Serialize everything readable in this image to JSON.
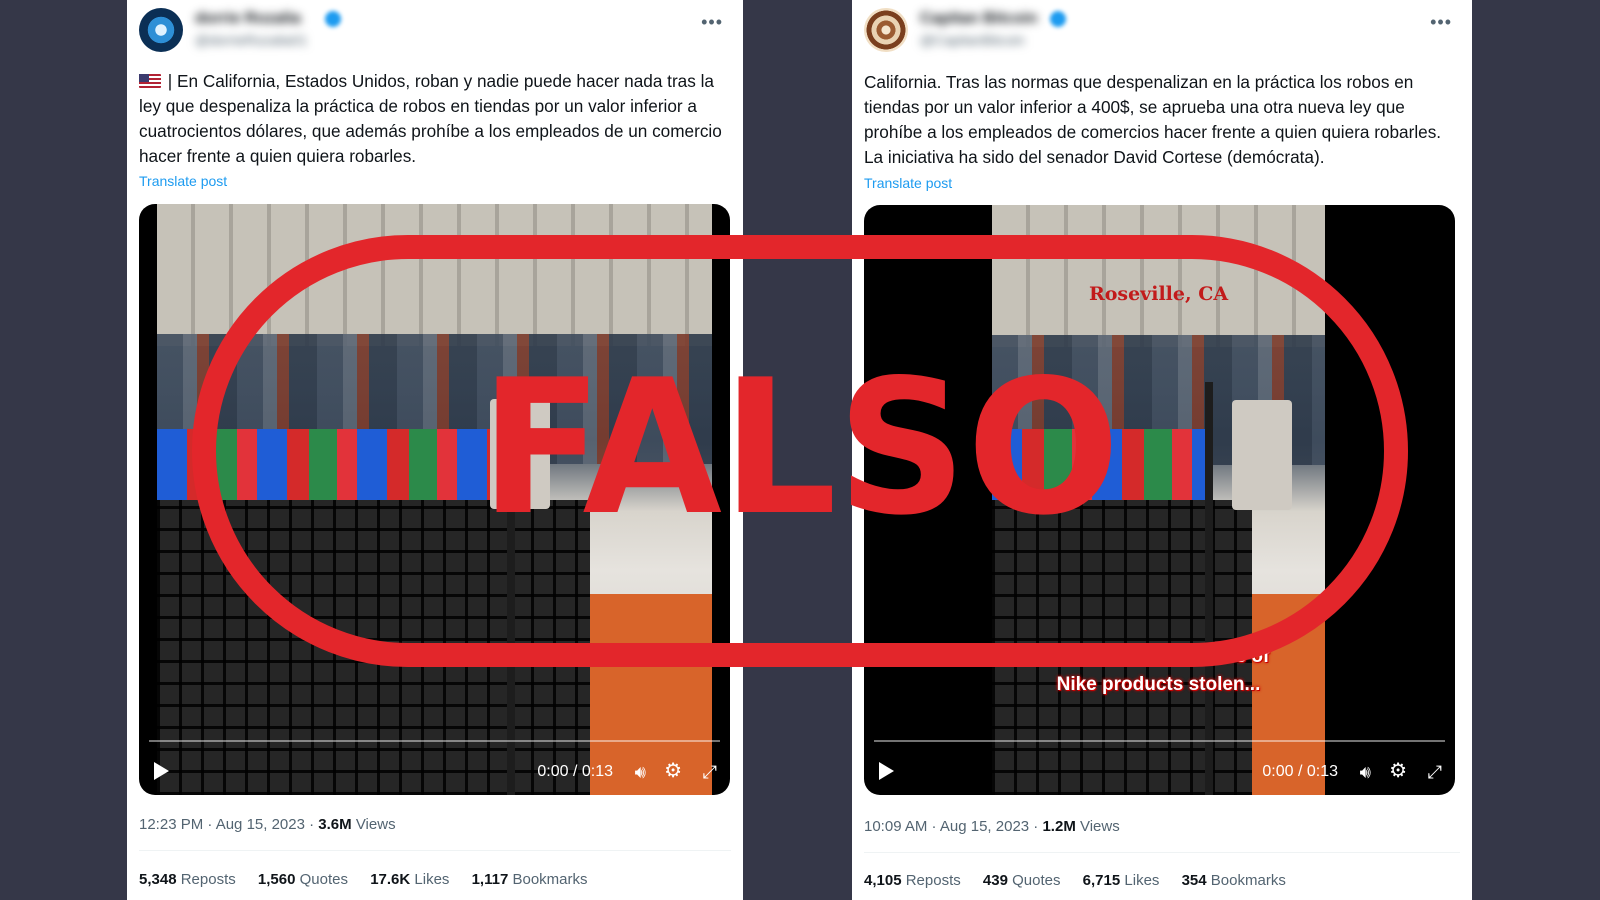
{
  "stamp": {
    "text": "FALSO",
    "color": "#e3262b"
  },
  "tweets": [
    {
      "username": "dorrie Rozalia",
      "handle": "@dorrieRozalia01",
      "has_flag": true,
      "text": " | En California, Estados Unidos, roban y nadie puede hacer nada tras la ley que despenaliza la práctica de robos en tiendas por un valor inferior a cuatrocientos dólares, que además prohíbe a los empleados de un comercio hacer frente a quien quiera robarles.",
      "translate": "Translate post",
      "video": {
        "time": "0:00 / 0:13",
        "overlay_top": "",
        "overlay_caption": ""
      },
      "timestamp": "12:23 PM · Aug 15, 2023 · ",
      "views_count": "3.6M",
      "views_label": " Views",
      "stats": [
        {
          "count": "5,348",
          "label": "Reposts"
        },
        {
          "count": "1,560",
          "label": "Quotes"
        },
        {
          "count": "17.6K",
          "label": "Likes"
        },
        {
          "count": "1,117",
          "label": "Bookmarks"
        }
      ]
    },
    {
      "username": "Capitan Bitcoin",
      "handle": "@CapitanBitcoin",
      "has_flag": false,
      "text": "California. Tras las normas que despenalizan en la práctica los robos en tiendas por un valor inferior a 400$, se aprueba una otra nueva ley que prohíbe a los empleados de comercios hacer frente a quien quiera robarles. La iniciativa ha sido del senador David Cortese (demócrata).",
      "translate": "Translate post",
      "video": {
        "time": "0:00 / 0:13",
        "overlay_top": "Roseville, CA",
        "overlay_caption_1": "HUNDREDS of dollars of",
        "overlay_caption_2": "Nike products stolen..."
      },
      "timestamp": "10:09 AM · Aug 15, 2023 · ",
      "views_count": "1.2M",
      "views_label": " Views",
      "stats": [
        {
          "count": "4,105",
          "label": "Reposts"
        },
        {
          "count": "439",
          "label": "Quotes"
        },
        {
          "count": "6,715",
          "label": "Likes"
        },
        {
          "count": "354",
          "label": "Bookmarks"
        }
      ]
    }
  ]
}
